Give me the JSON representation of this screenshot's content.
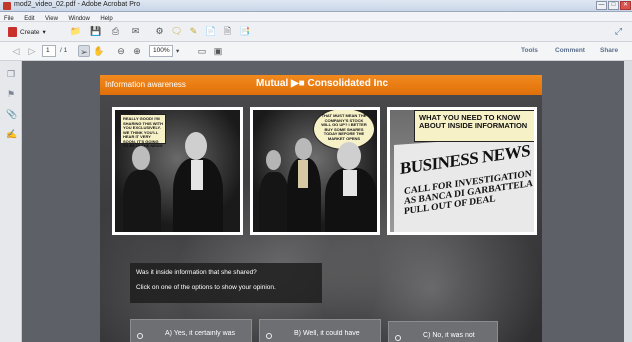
{
  "window": {
    "title": "mod2_video_02.pdf - Adobe Acrobat Pro",
    "controls": [
      "—",
      "□",
      "✕"
    ]
  },
  "menu": [
    "File",
    "Edit",
    "View",
    "Window",
    "Help"
  ],
  "toolbar": {
    "create_label": "Create",
    "create_dropdown": "▾"
  },
  "nav": {
    "current_page": "1",
    "page_total": "/ 1",
    "zoom": "100%",
    "zoom_dropdown": "▾"
  },
  "right_links": {
    "tools": "Tools",
    "comment": "Comment",
    "share": "Share"
  },
  "icons": {
    "create": "pdf-create-icon",
    "open": "folder-icon",
    "save": "save-icon",
    "print": "print-icon",
    "email": "email-icon",
    "settings": "gear-icon",
    "comment": "comment-icon",
    "share": "share-icon"
  },
  "document": {
    "banner_left": "Information awareness",
    "banner_right": "Mutual ▶■ Consolidated Inc",
    "bubble1": "Really good! I'm sharing this with you exclusively. We think you'll hear it very soon. It's going to be in the news",
    "bubble2": "That must mean the company's stock will go up? I better buy some shares today before the market opens",
    "headline": "WHAT YOU NEED TO KNOW ABOUT INSIDE INFORMATION",
    "news_title": "BUSINESS NEWS",
    "news_sub": "CALL FOR INVESTIGATION AS BANCA DI GARBATTELA PULL OUT OF DEAL",
    "question": "Was it inside information that she shared?",
    "instruction": "Click on one of the options to show your opinion.",
    "options": [
      "A) Yes, it certainly was",
      "B) Well, it could have",
      "C) No, it was not"
    ]
  },
  "colors": {
    "banner": "#e8780f",
    "accent_links": "#5a6f8c"
  }
}
